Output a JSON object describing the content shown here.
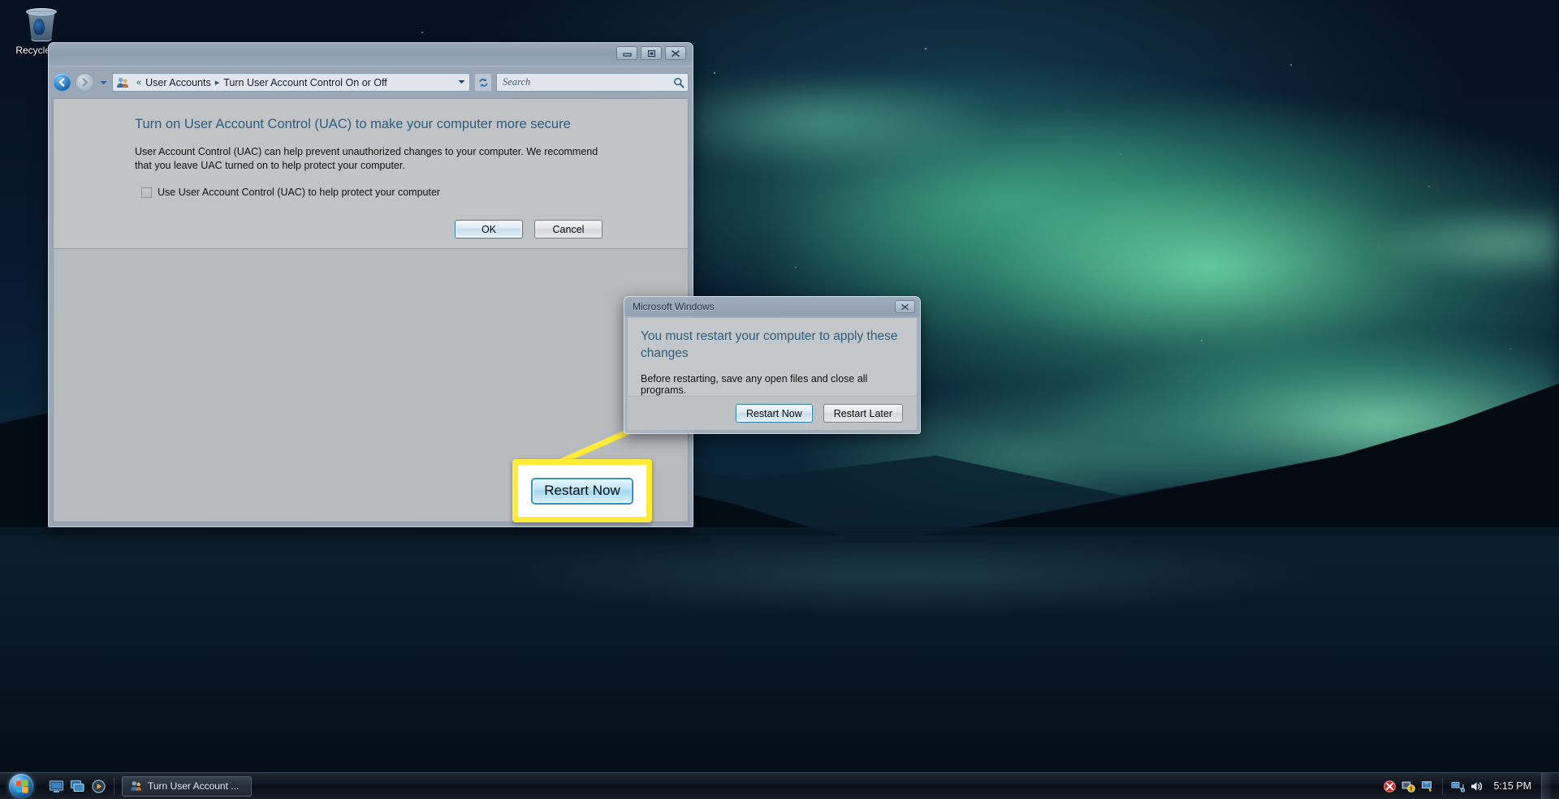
{
  "desktop": {
    "recycle_bin": {
      "label": "Recycle Bin",
      "icon": "recycle-bin-icon"
    }
  },
  "explorer_window": {
    "titlebar": {
      "minimize_label": "Minimize",
      "maximize_label": "Maximize",
      "close_label": "Close"
    },
    "navigation": {
      "back_label": "Back",
      "forward_label": "Forward",
      "recent_pages_label": "Recent Pages",
      "refresh_label": "Refresh",
      "address_icon": "user-accounts-icon",
      "breadcrumb_prefix": "«",
      "breadcrumbs": [
        "User Accounts",
        "Turn User Account Control On or Off"
      ],
      "breadcrumb_separator": "▸",
      "address_dropdown": "▼"
    },
    "search": {
      "placeholder": "Search",
      "icon": "search-icon"
    },
    "content": {
      "heading": "Turn on User Account Control (UAC) to make your computer more secure",
      "body": "User Account Control (UAC) can help prevent unauthorized changes to your computer.  We recommend that you leave UAC turned on to help protect your computer.",
      "checkbox": {
        "label": "Use User Account Control (UAC) to help protect your computer",
        "checked": false
      },
      "buttons": {
        "ok": "OK",
        "cancel": "Cancel"
      }
    }
  },
  "restart_dialog": {
    "title": "Microsoft Windows",
    "close_label": "Close",
    "heading": "You must restart your computer to apply these changes",
    "subtext": "Before restarting, save any open files and close all programs.",
    "buttons": {
      "restart_now": "Restart Now",
      "restart_later": "Restart Later"
    }
  },
  "callout": {
    "label": "Restart Now",
    "highlight_color": "#ffec38"
  },
  "taskbar": {
    "start_label": "Start",
    "quick_launch": [
      {
        "name": "show-desktop-icon"
      },
      {
        "name": "switch-windows-icon"
      },
      {
        "name": "media-player-icon"
      }
    ],
    "task_buttons": [
      {
        "label": "Turn User Account ...",
        "icon": "user-accounts-icon"
      }
    ],
    "tray_icons": [
      {
        "name": "security-alert-icon"
      },
      {
        "name": "windows-update-icon"
      },
      {
        "name": "flag-action-center-icon"
      },
      {
        "name": "network-icon"
      },
      {
        "name": "volume-icon"
      }
    ],
    "clock": "5:15 PM",
    "show_desktop_label": "Show desktop"
  }
}
